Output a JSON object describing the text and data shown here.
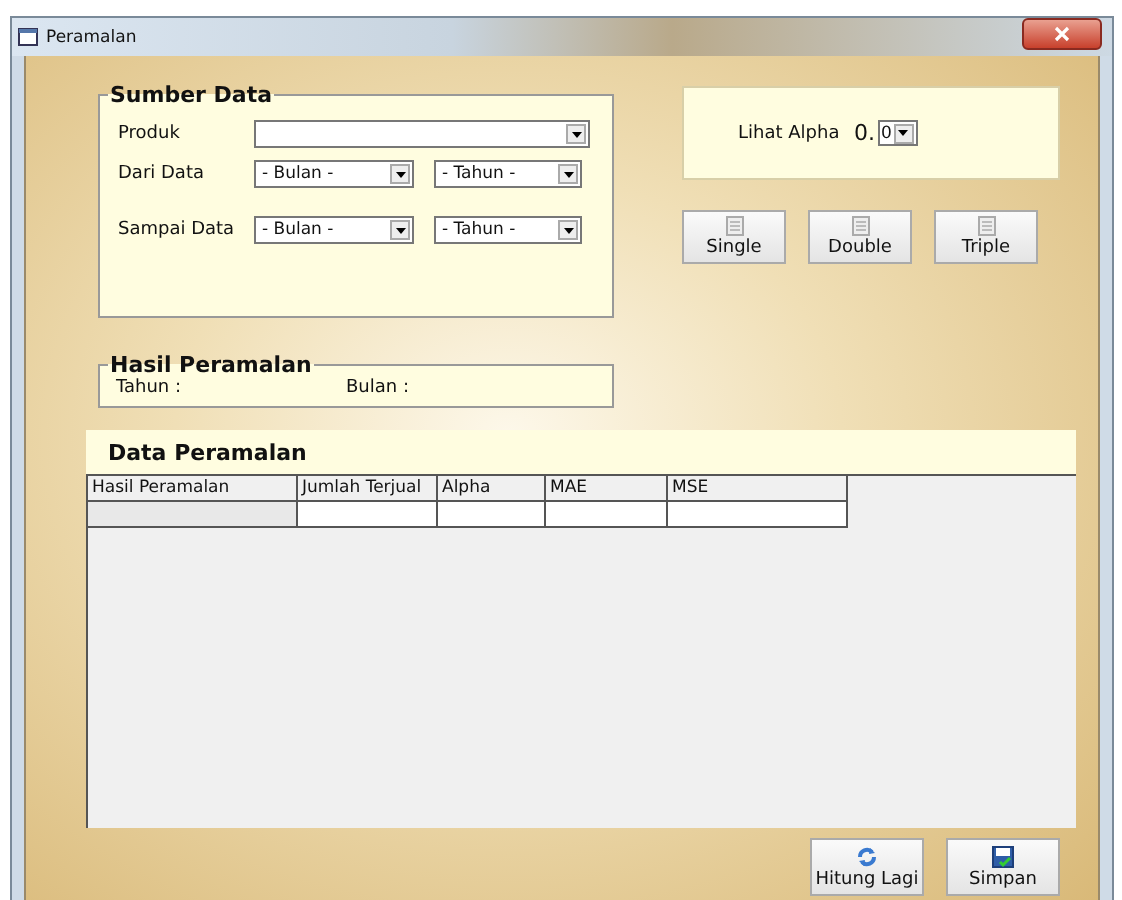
{
  "window": {
    "title": "Peramalan"
  },
  "sumber_data": {
    "title": "Sumber Data",
    "fields": [
      {
        "label": "Produk",
        "kind": "wide"
      },
      {
        "label": "Dari Data",
        "kind": "pair",
        "selects": [
          "- Bulan -",
          "- Tahun -"
        ]
      },
      {
        "label": "Sampai Data",
        "kind": "pair",
        "selects": [
          "- Bulan -",
          "- Tahun -"
        ]
      }
    ]
  },
  "alpha": {
    "label": "Lihat Alpha",
    "prefix": "0.",
    "value": "0"
  },
  "method_buttons": [
    "Single",
    "Double",
    "Triple"
  ],
  "hasil": {
    "title": "Hasil Peramalan",
    "labels": [
      "Tahun :",
      "Bulan :"
    ]
  },
  "table": {
    "title": "Data Peramalan",
    "columns": [
      "Hasil Peramalan",
      "Jumlah Terjual",
      "Alpha",
      "MAE",
      "MSE"
    ]
  },
  "buttons": [
    {
      "label": "Hitung Lagi",
      "kind": "refresh"
    },
    {
      "label": "Simpan",
      "kind": "save"
    }
  ]
}
